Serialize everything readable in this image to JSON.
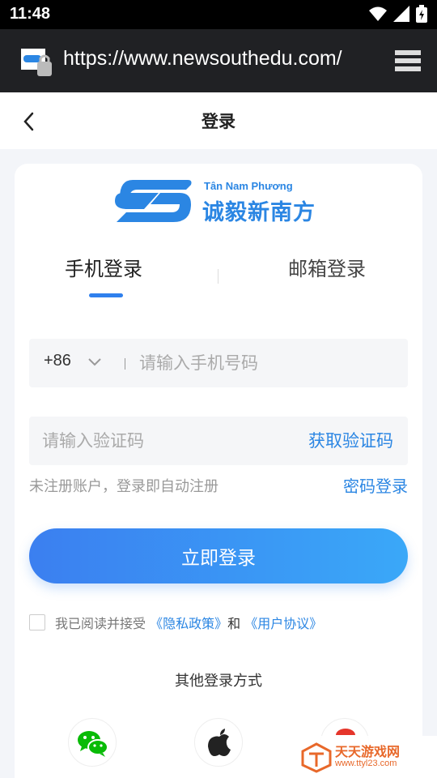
{
  "status_bar": {
    "time": "11:48"
  },
  "browser": {
    "url": "https://www.newsouthedu.com/"
  },
  "header": {
    "title": "登录"
  },
  "brand": {
    "name_vi": "Tân Nam Phương",
    "name_cn": "诚毅新南方",
    "color": "#2b86e3"
  },
  "tabs": [
    {
      "label": "手机登录",
      "active": true
    },
    {
      "label": "邮箱登录",
      "active": false
    }
  ],
  "phone_field": {
    "country_code": "+86",
    "placeholder": "请输入手机号码",
    "value": ""
  },
  "code_field": {
    "placeholder": "请输入验证码",
    "value": "",
    "get_code_label": "获取验证码"
  },
  "hint": {
    "text": "未注册账户，登录即自动注册",
    "password_login": "密码登录"
  },
  "login_button": {
    "label": "立即登录"
  },
  "agreement": {
    "prefix": "我已阅读并接受",
    "privacy": "《隐私政策》",
    "and": "和",
    "terms": "《用户协议》",
    "checked": false
  },
  "other_login": {
    "title": "其他登录方式",
    "options": [
      "wechat-icon",
      "apple-icon",
      "weibo-icon"
    ]
  },
  "watermark": {
    "main": "天天游戏网",
    "sub": "www.ttyl23.com"
  },
  "colors": {
    "accent": "#2f80ed",
    "link": "#2b86e3",
    "status_bar": "#000000",
    "url_bar": "#202124"
  }
}
